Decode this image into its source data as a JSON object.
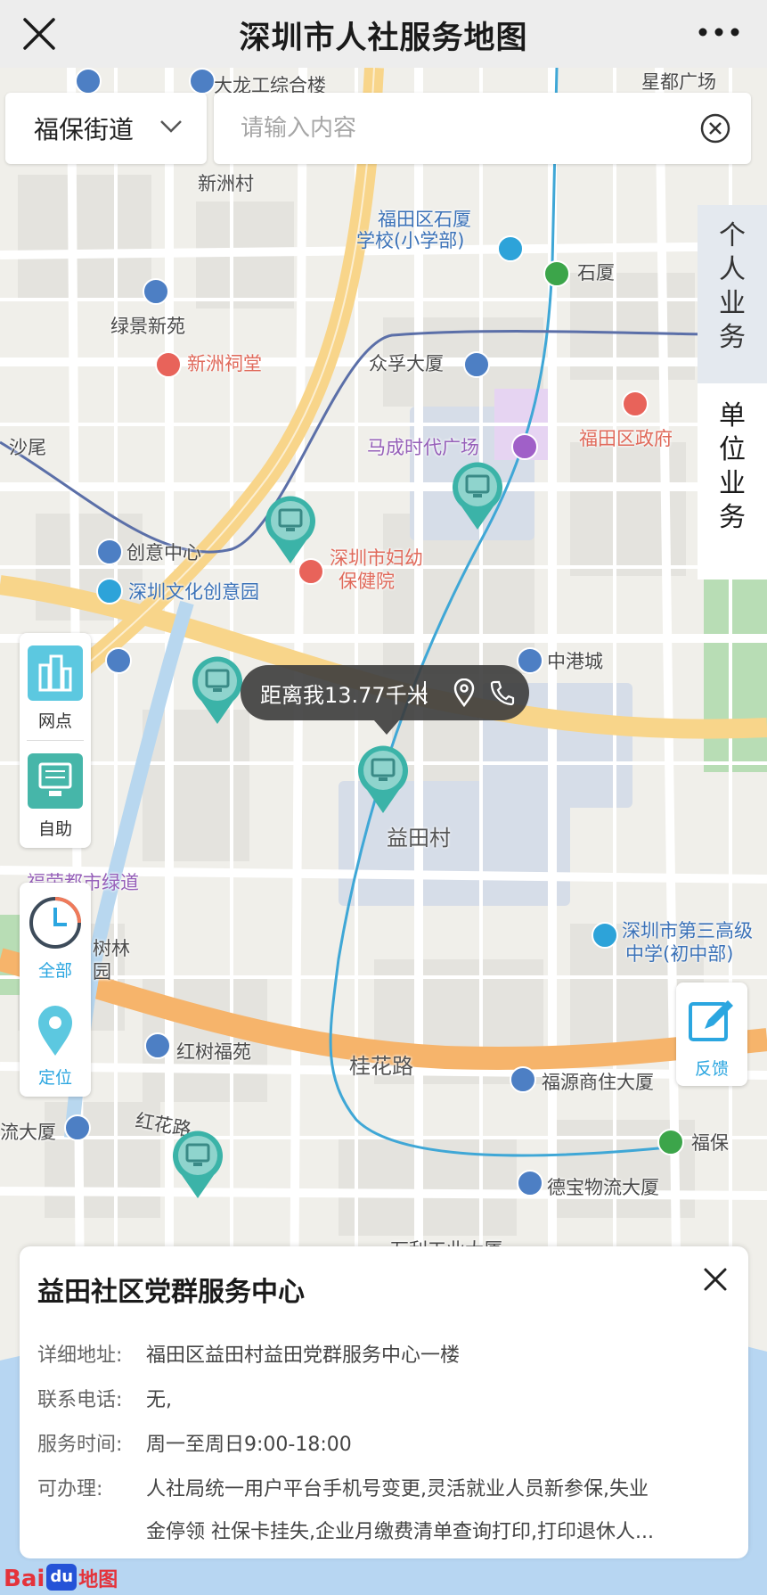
{
  "window": {
    "title": "深圳市人社服务地图"
  },
  "search": {
    "district": "福保街道",
    "placeholder": "请输入内容"
  },
  "side_tabs": {
    "personal": [
      "个",
      "人",
      "业",
      "务"
    ],
    "company": [
      "单",
      "位",
      "业",
      "务"
    ]
  },
  "controls": {
    "outlets_label": "网点",
    "selfservice_label": "自助",
    "all_label": "全部",
    "locate_label": "定位",
    "feedback_label": "反馈"
  },
  "map": {
    "labels": {
      "top1": "大龙工综合楼",
      "top2": "星都广场",
      "xinzhoucun": "新洲村",
      "shixia_school_1": "福田区石厦",
      "shixia_school_2": "学校(小学部)",
      "shixia_station": "石厦",
      "lvjing": "绿景新苑",
      "xinzhou_temple": "新洲祠堂",
      "zhongfu": "众孚大厦",
      "shawei": "沙尾",
      "macheng": "马成时代广场",
      "futian_gov": "福田区政府",
      "chuangyi": "创意中心",
      "fuyou_1": "深圳市妇幼",
      "fuyou_2": "保健院",
      "wenhua": "深圳文化创意园",
      "zhonggang": "中港城",
      "yitiancun": "益田村",
      "lvdao": "福荣都市绿道",
      "school3_1": "深圳市第三高级",
      "school3_2": "中学(初中部)",
      "shulin_1": "树林",
      "shulin_2": "园",
      "hongshu": "红树福苑",
      "guihua": "桂花路",
      "fuyuan": "福源商住大厦",
      "liu": "流大厦",
      "honghua": "红花路",
      "fubao": "福保",
      "debao": "德宝物流大厦",
      "gongye": "万利工业大厦"
    },
    "line_colors": {
      "metro_blue": "#3fa7d6",
      "road_orange": "#f6b46b",
      "road_yellow": "#f8d58a"
    }
  },
  "bubble": {
    "distance": "距离我13.77千米"
  },
  "detail": {
    "name": "益田社区党群服务中心",
    "address_label": "详细地址:",
    "address": "福田区益田村益田党群服务中心一楼",
    "phone_label": "联系电话:",
    "phone": "无,",
    "hours_label": "服务时间:",
    "hours": "周一至周日9:00-18:00",
    "services_label": "可办理:",
    "services_line1": "人社局统一用户平台手机号变更,灵活就业人员新参保,失业",
    "services_line2": "金停领 社保卡挂失,企业月缴费清单查询打印,打印退休人..."
  },
  "logo": {
    "bai": "Bai",
    "du": "du",
    "ditu": "地图"
  }
}
